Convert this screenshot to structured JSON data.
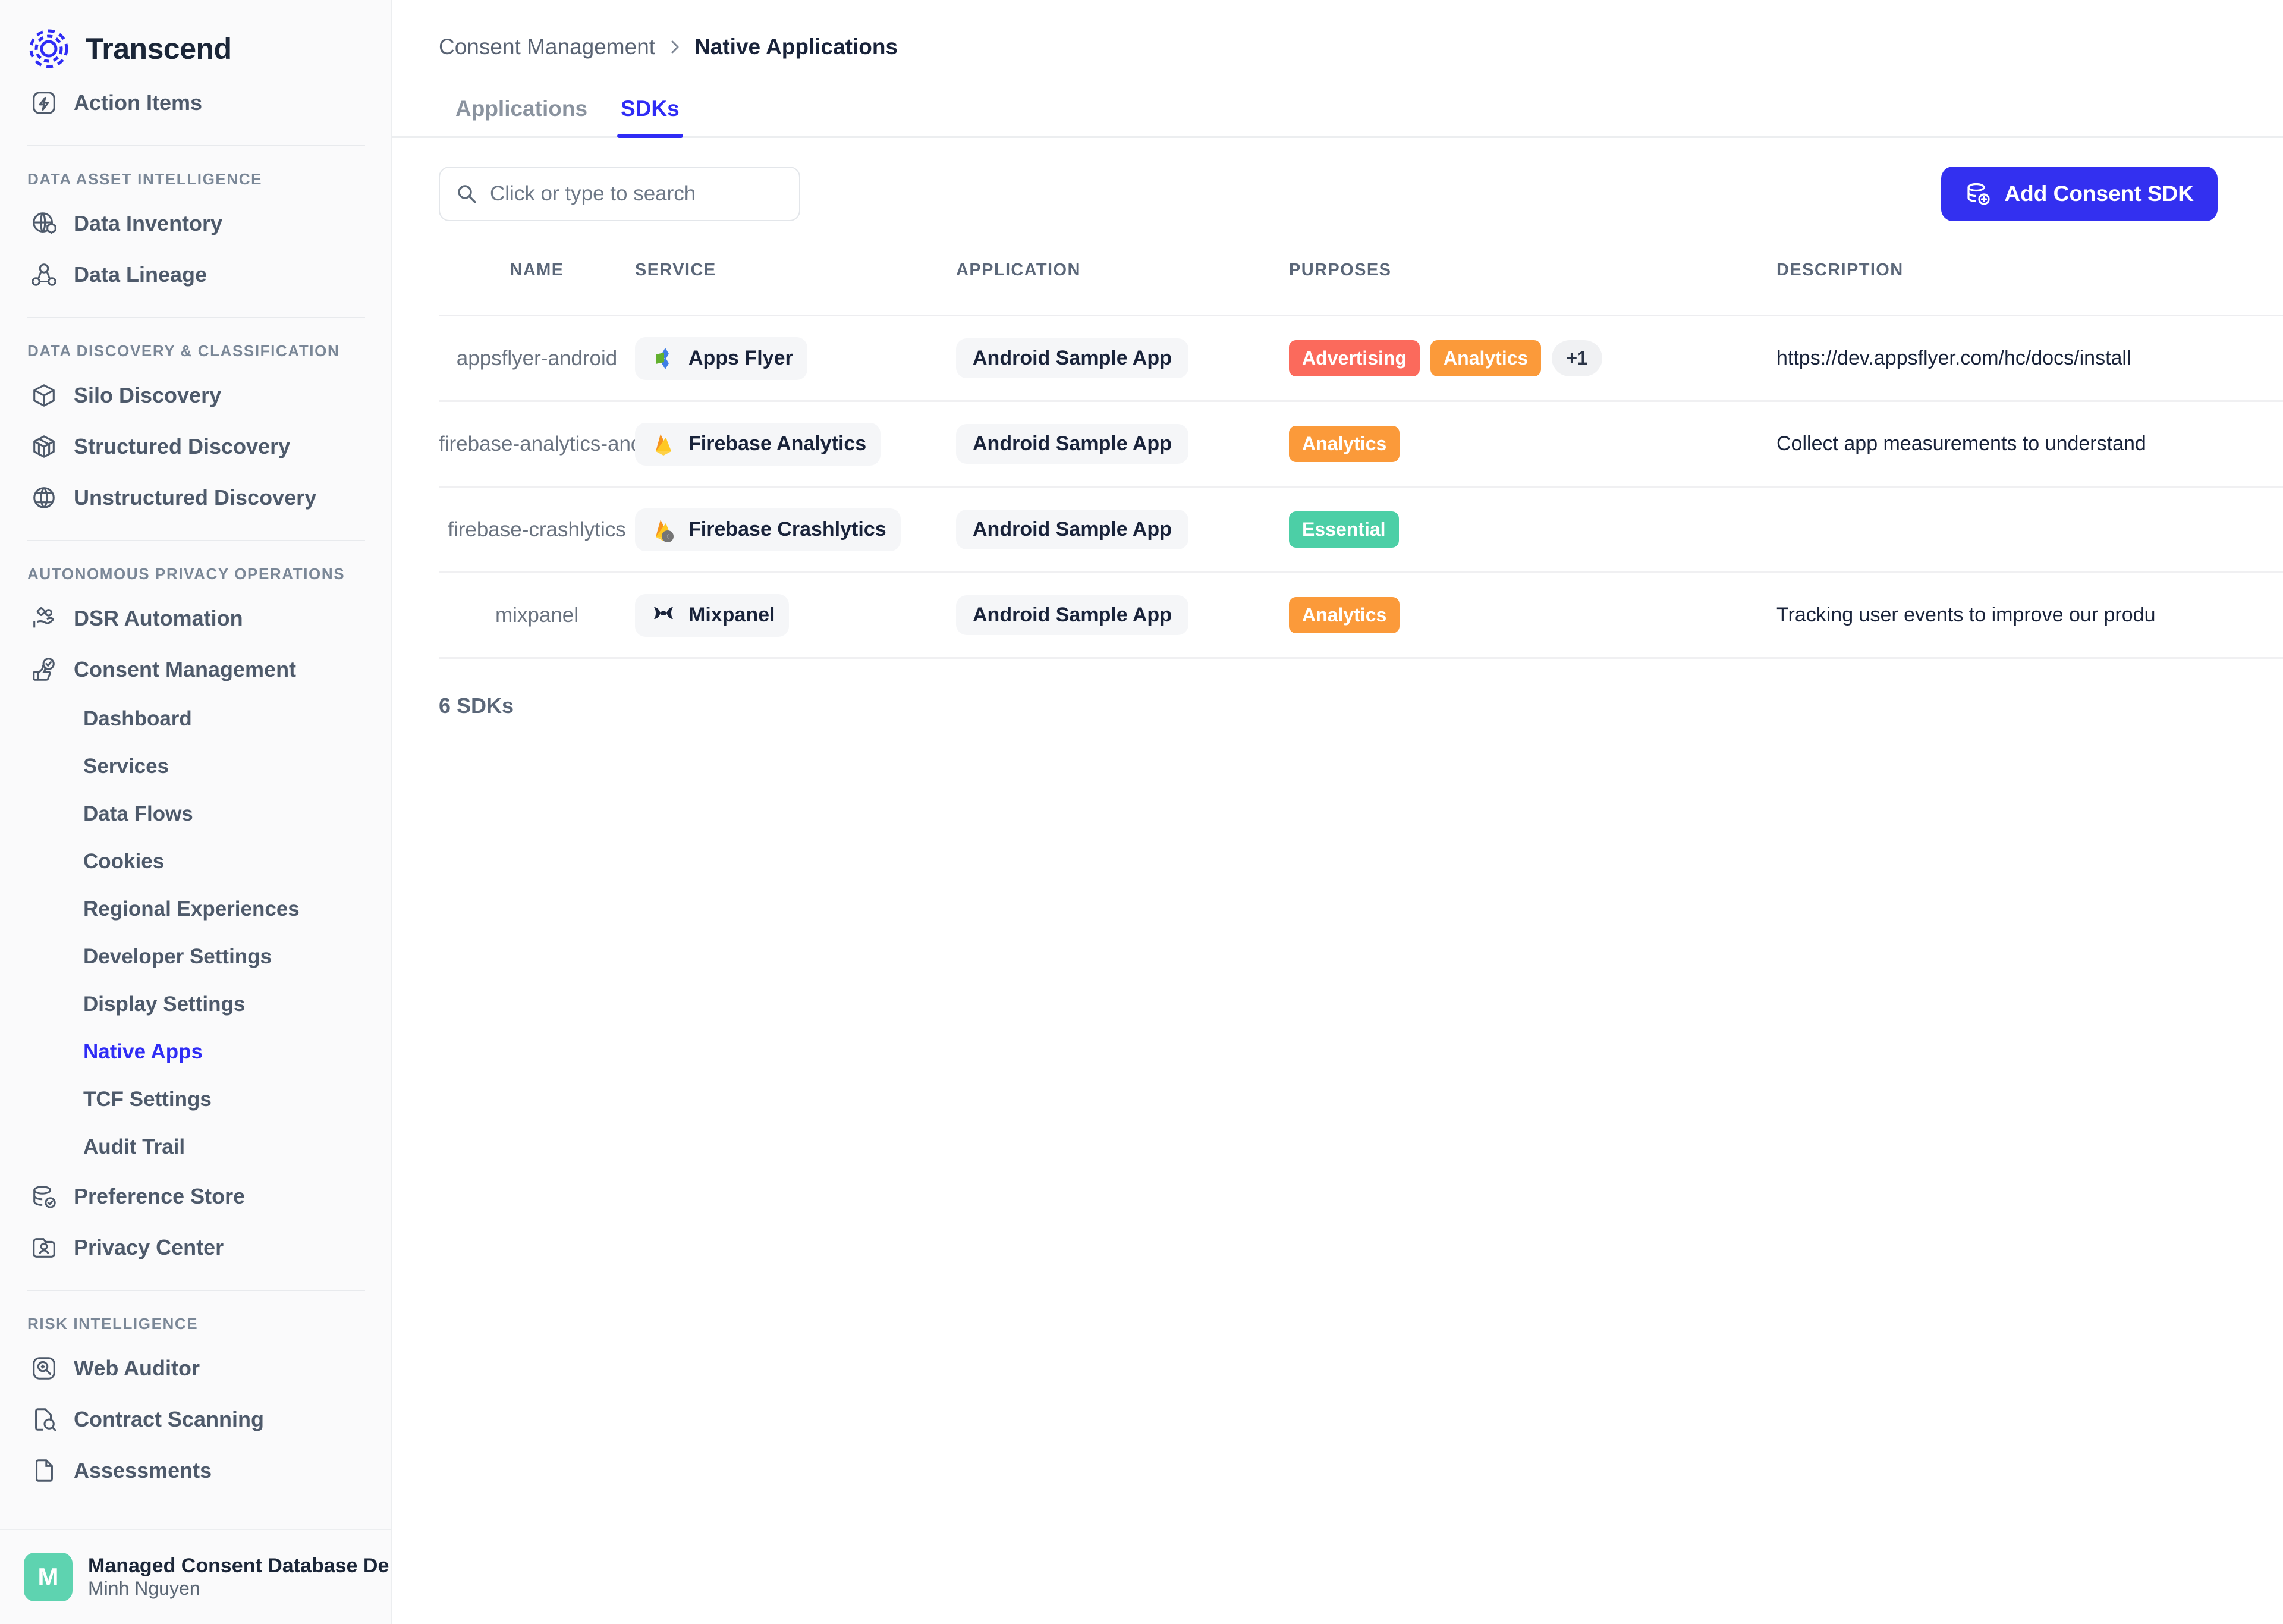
{
  "brand": {
    "name": "Transcend",
    "logo_icon": "transcend-logo-icon"
  },
  "sidebar": {
    "top_items": [
      {
        "label": "Action Items",
        "icon": "bolt-square-icon"
      }
    ],
    "sections": [
      {
        "title": "DATA ASSET INTELLIGENCE",
        "items": [
          {
            "label": "Data Inventory",
            "icon": "globe-box-icon"
          },
          {
            "label": "Data Lineage",
            "icon": "lineage-nodes-icon"
          }
        ]
      },
      {
        "title": "DATA DISCOVERY & CLASSIFICATION",
        "items": [
          {
            "label": "Silo Discovery",
            "icon": "cube-icon"
          },
          {
            "label": "Structured Discovery",
            "icon": "cube-grid-icon"
          },
          {
            "label": "Unstructured Discovery",
            "icon": "globe-leaf-icon"
          }
        ]
      },
      {
        "title": "AUTONOMOUS PRIVACY OPERATIONS",
        "items": [
          {
            "label": "DSR Automation",
            "icon": "hand-data-icon"
          },
          {
            "label": "Consent Management",
            "icon": "thumbs-up-check-icon"
          }
        ],
        "subitems": [
          {
            "label": "Dashboard",
            "active": false
          },
          {
            "label": "Services",
            "active": false
          },
          {
            "label": "Data Flows",
            "active": false
          },
          {
            "label": "Cookies",
            "active": false
          },
          {
            "label": "Regional Experiences",
            "active": false
          },
          {
            "label": "Developer Settings",
            "active": false
          },
          {
            "label": "Display Settings",
            "active": false
          },
          {
            "label": "Native Apps",
            "active": true
          },
          {
            "label": "TCF Settings",
            "active": false
          },
          {
            "label": "Audit Trail",
            "active": false
          }
        ],
        "trailing_items": [
          {
            "label": "Preference Store",
            "icon": "database-check-icon"
          },
          {
            "label": "Privacy Center",
            "icon": "id-card-icon"
          }
        ]
      },
      {
        "title": "RISK INTELLIGENCE",
        "items": [
          {
            "label": "Web Auditor",
            "icon": "magnifier-square-icon"
          },
          {
            "label": "Contract Scanning",
            "icon": "document-search-icon"
          },
          {
            "label": "Assessments",
            "icon": "document-icon"
          }
        ]
      }
    ],
    "user": {
      "avatar_initial": "M",
      "avatar_color": "#5ed3b0",
      "org": "Managed Consent Database De",
      "name": "Minh Nguyen"
    }
  },
  "header": {
    "breadcrumb_parent": "Consent Management",
    "breadcrumb_current": "Native Applications",
    "chevron_icon": "chevron-right-icon"
  },
  "tabs": [
    {
      "label": "Applications",
      "active": false
    },
    {
      "label": "SDKs",
      "active": true
    }
  ],
  "toolbar": {
    "search_placeholder": "Click or type to search",
    "search_value": "",
    "search_icon": "search-icon",
    "add_button_label": "Add Consent SDK",
    "add_button_icon": "database-plus-icon",
    "add_button_color": "#3330f0"
  },
  "table": {
    "columns": [
      "NAME",
      "SERVICE",
      "APPLICATION",
      "PURPOSES",
      "DESCRIPTION"
    ],
    "rows": [
      {
        "name": "appsflyer-android",
        "service": "Apps Flyer",
        "service_icon": "appsflyer-logo-icon",
        "application": "Android Sample App",
        "purposes": [
          {
            "label": "Advertising",
            "kind": "adv"
          },
          {
            "label": "Analytics",
            "kind": "ana"
          }
        ],
        "overflow": "+1",
        "description": "https://dev.appsflyer.com/hc/docs/install"
      },
      {
        "name": "firebase-analytics-android",
        "service": "Firebase Analytics",
        "service_icon": "firebase-logo-icon",
        "application": "Android Sample App",
        "purposes": [
          {
            "label": "Analytics",
            "kind": "ana"
          }
        ],
        "overflow": "",
        "description": "Collect app measurements to understand"
      },
      {
        "name": "firebase-crashlytics",
        "service": "Firebase Crashlytics",
        "service_icon": "firebase-crashlytics-logo-icon",
        "application": "Android Sample App",
        "purposes": [
          {
            "label": "Essential",
            "kind": "ess"
          }
        ],
        "overflow": "",
        "description": ""
      },
      {
        "name": "mixpanel",
        "service": "Mixpanel",
        "service_icon": "mixpanel-logo-icon",
        "application": "Android Sample App",
        "purposes": [
          {
            "label": "Analytics",
            "kind": "ana"
          }
        ],
        "overflow": "",
        "description": "Tracking user events to improve our produ"
      }
    ],
    "count_label": "6 SDKs"
  },
  "colors": {
    "accent": "#2f2cf5",
    "advertising": "#fb6a5c",
    "analytics": "#fb9a3a",
    "essential": "#4ccfa6"
  }
}
